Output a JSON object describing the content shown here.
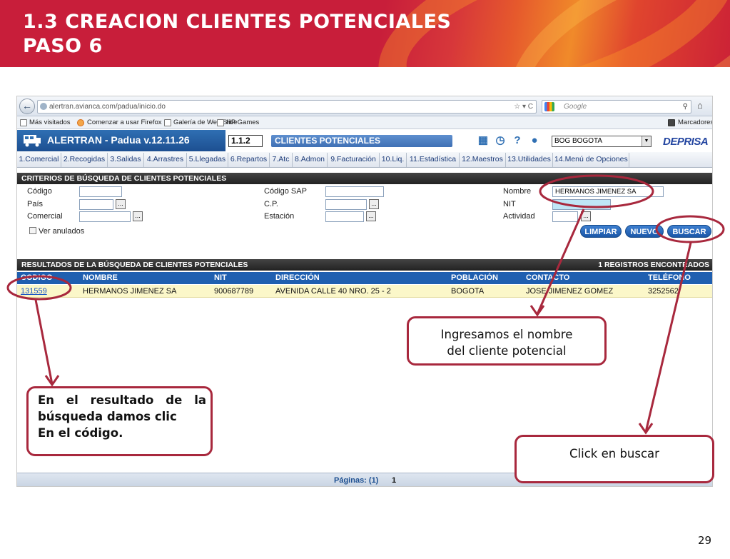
{
  "slide": {
    "title_line1": "1.3 CREACION CLIENTES POTENCIALES",
    "title_line2": "PASO 6",
    "page_number": "29"
  },
  "browser": {
    "url": "alertran.avianca.com/padua/inicio.do",
    "search_placeholder": "Google",
    "bookmarks": [
      "Más visitados",
      "Comenzar a usar Firefox",
      "Galería de Web Slice",
      "HP Games"
    ],
    "bookmarks_right": "Marcadores"
  },
  "app": {
    "title": "ALERTRAN - Padua  v.12.11.26",
    "module_code": "1.1.2",
    "module_name": "CLIENTES POTENCIALES",
    "station": "BOG BOGOTA",
    "brand": "DEPRISA",
    "menu": [
      "1.Comercial",
      "2.Recogidas",
      "3.Salidas",
      "4.Arrastres",
      "5.Llegadas",
      "6.Repartos",
      "7.Atc",
      "8.Admon",
      "9.Facturación",
      "10.Liq.",
      "11.Estadística",
      "12.Maestros",
      "13.Utilidades",
      "14.Menú de Opciones"
    ]
  },
  "criteria": {
    "header": "CRITERIOS DE BÚSQUEDA DE CLIENTES POTENCIALES",
    "labels": {
      "codigo": "Código",
      "pais": "País",
      "comercial": "Comercial",
      "codigo_sap": "Código SAP",
      "cp": "C.P.",
      "estacion": "Estación",
      "nombre": "Nombre",
      "nit": "NIT",
      "actividad": "Actividad"
    },
    "nombre_value": "HERMANOS JIMENEZ SA",
    "dots": "...",
    "ver_anulados": "Ver anulados",
    "buttons": {
      "limpiar": "LIMPIAR",
      "nuevo": "NUEVO",
      "buscar": "BUSCAR"
    }
  },
  "results": {
    "header": "RESULTADOS DE LA BÚSQUEDA DE CLIENTES POTENCIALES",
    "count": "1 REGISTROS ENCONTRADOS",
    "columns": [
      "CODIGO",
      "NOMBRE",
      "NIT",
      "DIRECCIÓN",
      "POBLACIÓN",
      "CONTACTO",
      "TELÉFONO"
    ],
    "rows": [
      [
        "131559",
        "HERMANOS JIMENEZ SA",
        "900687789",
        "AVENIDA  CALLE 40 NRO. 25 - 2",
        "BOGOTA",
        "JOSE JIMENEZ GOMEZ",
        "3252562"
      ]
    ],
    "pages_label": "Páginas: (1)",
    "current_page": "1"
  },
  "callouts": {
    "nombre_line1": "Ingresamos el nombre",
    "nombre_line2": "del cliente potencial",
    "codigo_line1": "En el resultado de la",
    "codigo_line2": "búsqueda damos clic",
    "codigo_line3": "En el código.",
    "buscar": "Click en buscar"
  },
  "colors": {
    "annotation": "#a8283d",
    "header_red": "#c81e3a",
    "app_blue": "#1f5fb0"
  }
}
